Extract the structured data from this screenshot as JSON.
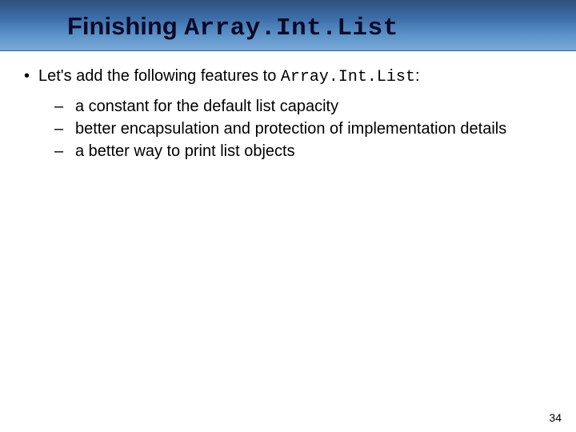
{
  "header": {
    "title_prefix": "Finishing ",
    "title_code": "Array.Int.List"
  },
  "bullet": {
    "marker": "•",
    "text_before_code": "Let's add the following features to ",
    "code": "Array.Int.List",
    "text_after_code": ":"
  },
  "subitems": [
    {
      "dash": "–",
      "text": "a constant for the default list capacity"
    },
    {
      "dash": "–",
      "text": "better encapsulation and protection of implementation details"
    },
    {
      "dash": "–",
      "text": "a better way to print list objects"
    }
  ],
  "pageNumber": "34"
}
